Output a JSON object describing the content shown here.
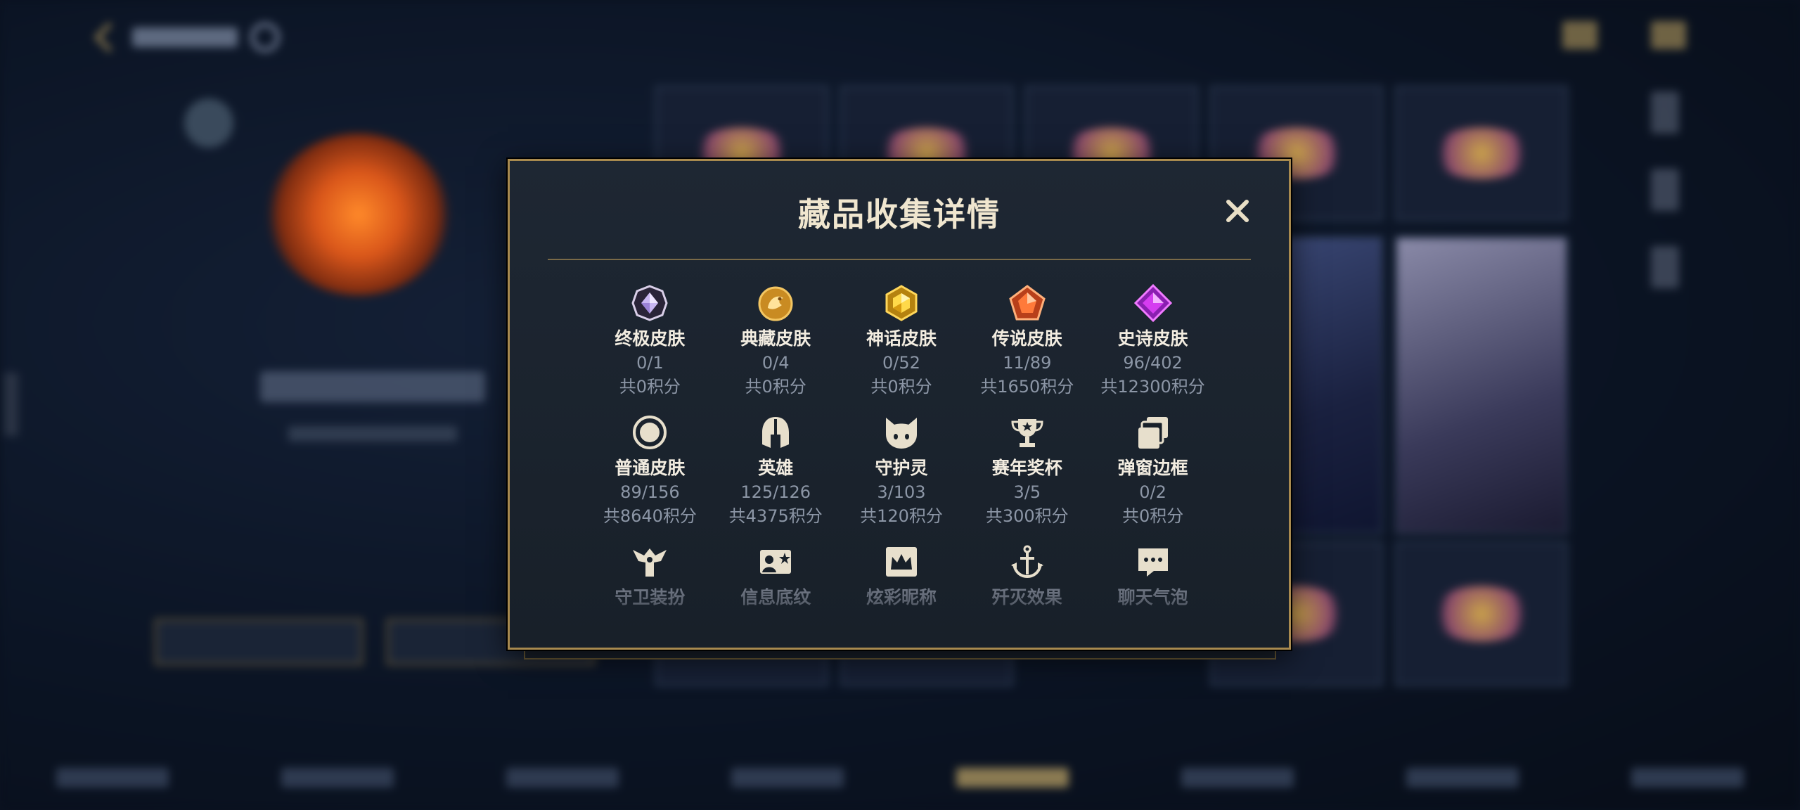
{
  "dialog": {
    "title": "藏品收集详情",
    "close_icon": "close-icon"
  },
  "items_row1": [
    {
      "icon": "ultimate-skin-icon",
      "name": "终极皮肤",
      "count": "0/1",
      "points": "共0积分"
    },
    {
      "icon": "collection-skin-icon",
      "name": "典藏皮肤",
      "count": "0/4",
      "points": "共0积分"
    },
    {
      "icon": "mythic-skin-icon",
      "name": "神话皮肤",
      "count": "0/52",
      "points": "共0积分"
    },
    {
      "icon": "legend-skin-icon",
      "name": "传说皮肤",
      "count": "11/89",
      "points": "共1650积分"
    },
    {
      "icon": "epic-skin-icon",
      "name": "史诗皮肤",
      "count": "96/402",
      "points": "共12300积分"
    }
  ],
  "items_row2": [
    {
      "icon": "normal-skin-icon",
      "name": "普通皮肤",
      "count": "89/156",
      "points": "共8640积分"
    },
    {
      "icon": "hero-helmet-icon",
      "name": "英雄",
      "count": "125/126",
      "points": "共4375积分"
    },
    {
      "icon": "guardian-spirit-icon",
      "name": "守护灵",
      "count": "3/103",
      "points": "共120积分"
    },
    {
      "icon": "trophy-icon",
      "name": "赛年奖杯",
      "count": "3/5",
      "points": "共300积分"
    },
    {
      "icon": "popup-frame-icon",
      "name": "弹窗边框",
      "count": "0/2",
      "points": "共0积分"
    }
  ],
  "items_row3": [
    {
      "icon": "guard-outfit-icon",
      "name": "守卫装扮"
    },
    {
      "icon": "info-card-icon",
      "name": "信息底纹"
    },
    {
      "icon": "colorful-nickname-icon",
      "name": "炫彩昵称"
    },
    {
      "icon": "kill-effect-icon",
      "name": "歼灭效果"
    },
    {
      "icon": "chat-bubble-icon",
      "name": "聊天气泡"
    }
  ]
}
